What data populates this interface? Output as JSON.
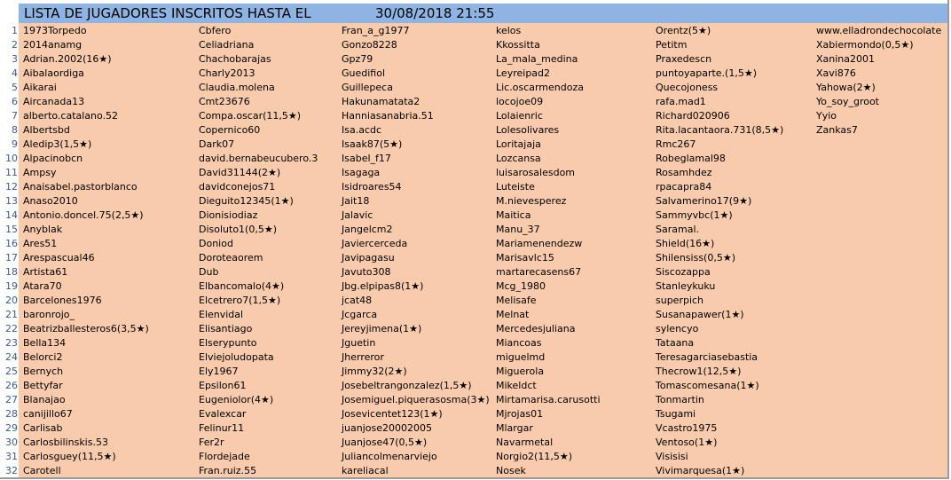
{
  "header": {
    "title": "LISTA DE JUGADORES INSCRITOS HASTA   EL",
    "datetime": "30/08/2018 21:55"
  },
  "row_numbers": [
    "1",
    "2",
    "3",
    "4",
    "5",
    "6",
    "7",
    "8",
    "9",
    "10",
    "11",
    "12",
    "13",
    "14",
    "15",
    "16",
    "17",
    "18",
    "19",
    "20",
    "21",
    "22",
    "23",
    "24",
    "25",
    "26",
    "27",
    "28",
    "29",
    "30",
    "31",
    "32"
  ],
  "columns": [
    [
      "1973Torpedo",
      "2014anamg",
      "Adrian.2002(16★)",
      "Aibalaordiga",
      "Aikarai",
      "Aircanada13",
      "alberto.catalano.52",
      "Albertsbd",
      "Aledip3(1,5★)",
      "Alpacinobcn",
      "Ampsy",
      "Anaisabel.pastorblanco",
      "Anaso2010",
      "Antonio.doncel.75(2,5★)",
      "Anyblak",
      "Ares51",
      "Arespascual46",
      "Artista61",
      "Atara70",
      "Barcelones1976",
      "baronrojo_",
      "Beatrizballesteros6(3,5★)",
      "Bella134",
      "Belorci2",
      "Bernych",
      "Bettyfar",
      "Blanajao",
      "canijillo67",
      "Carlisab",
      "Carlosbilinskis.53",
      "Carlosguey(11,5★)",
      "Carotell"
    ],
    [
      "Cbfero",
      "Celiadriana",
      "Chachobarajas",
      "Charly2013",
      "Claudia.molena",
      "Cmt23676",
      "Compa.oscar(11,5★)",
      "Copernico60",
      "Dark07",
      "david.bernabeucubero.3",
      "David31144(2★)",
      "davidconejos71",
      "Dieguito12345(1★)",
      "Dionisiodiaz",
      "Disoluto1(0,5★)",
      "Doniod",
      "Doroteaorem",
      "Dub",
      "Elbancomalo(4★)",
      "Elcetrero7(1,5★)",
      "Elenvidal",
      "Elisantiago",
      "Elserypunto",
      "Elviejoludopata",
      "Ely1967",
      "Epsilon61",
      "Eugeniolor(4★)",
      "Evalexcar",
      "Felinur11",
      "Fer2r",
      "Flordejade",
      "Fran.ruiz.55"
    ],
    [
      "Fran_a_g1977",
      "Gonzo8228",
      "Gpz79",
      "Guedifiol",
      "Guillepeca",
      "Hakunamatata2",
      "Hanniasanabria.51",
      "Isa.acdc",
      "Isaak87(5★)",
      "Isabel_f17",
      "Isagaga",
      "Isidroares54",
      "Jait18",
      "Jalavic",
      "Jangelcm2",
      "Javiercerceda",
      "Javipagasu",
      "Javuto308",
      "Jbg.elpipas8(1★)",
      "jcat48",
      "Jcgarca",
      "Jereyjimena(1★)",
      "Jguetin",
      "Jherreror",
      "Jimmy32(2★)",
      "Josebeltrangonzalez(1,5★)",
      "Josemiguel.piquerasosma(3★)",
      "Josevicentet123(1★)",
      "juanjose20002005",
      "Juanjose47(0,5★)",
      "Juliancolmenarviejo",
      "kareliacal"
    ],
    [
      "kelos",
      "Kkossitta",
      "La_mala_medina",
      "Leyreipad2",
      "Lic.oscarmendoza",
      "locojoe09",
      "Lolaienric",
      "Lolesolivares",
      "Loritajaja",
      "Lozcansa",
      "luisarosalesdom",
      "Luteiste",
      "M.nievesperez",
      "Maitica",
      "Manu_37",
      "Mariamenendezw",
      "Marisavlc15",
      "martarecasens67",
      "Mcg_1980",
      "Melisafe",
      "Melnat",
      "Mercedesjuliana",
      "Miancoas",
      "miguelmd",
      "Miguerola",
      "Mikeldct",
      "Mirtamarisa.carusotti",
      "Mjrojas01",
      "Mlargar",
      "Navarmetal",
      "Norgio2(11,5★)",
      "Nosek"
    ],
    [
      "Orentz(5★)",
      "Petitm",
      "Praxedescn",
      "puntoyaparte.(1,5★)",
      "Quecojoness",
      "rafa.mad1",
      "Richard020906",
      "Rita.lacantaora.731(8,5★)",
      "Rmc267",
      "Robeglamal98",
      "Rosamhdez",
      "rpacapra84",
      "Salvamerino17(9★)",
      "Sammyvbc(1★)",
      "Saramal.",
      "Shield(16★)",
      "Shilensiss(0,5★)",
      "Siscozappa",
      "Stanleykuku",
      "superpich",
      "Susanapawer(1★)",
      "sylencyo",
      "Tataana",
      "Teresagarciasebastia",
      "Thecrow1(12,5★)",
      "Tomascomesana(1★)",
      "Tonmartin",
      "Tsugami",
      "Vcastro1975",
      "Ventoso(1★)",
      "Visisisi",
      "Vivimarquesa(1★)"
    ],
    [
      "www.elladrondechocolate",
      "Xabiermondo(0,5★)",
      "Xanina2001",
      "Xavi876",
      "Yahowa(2★)",
      "Yo_soy_groot",
      "Yyio",
      "Zankas7"
    ]
  ]
}
